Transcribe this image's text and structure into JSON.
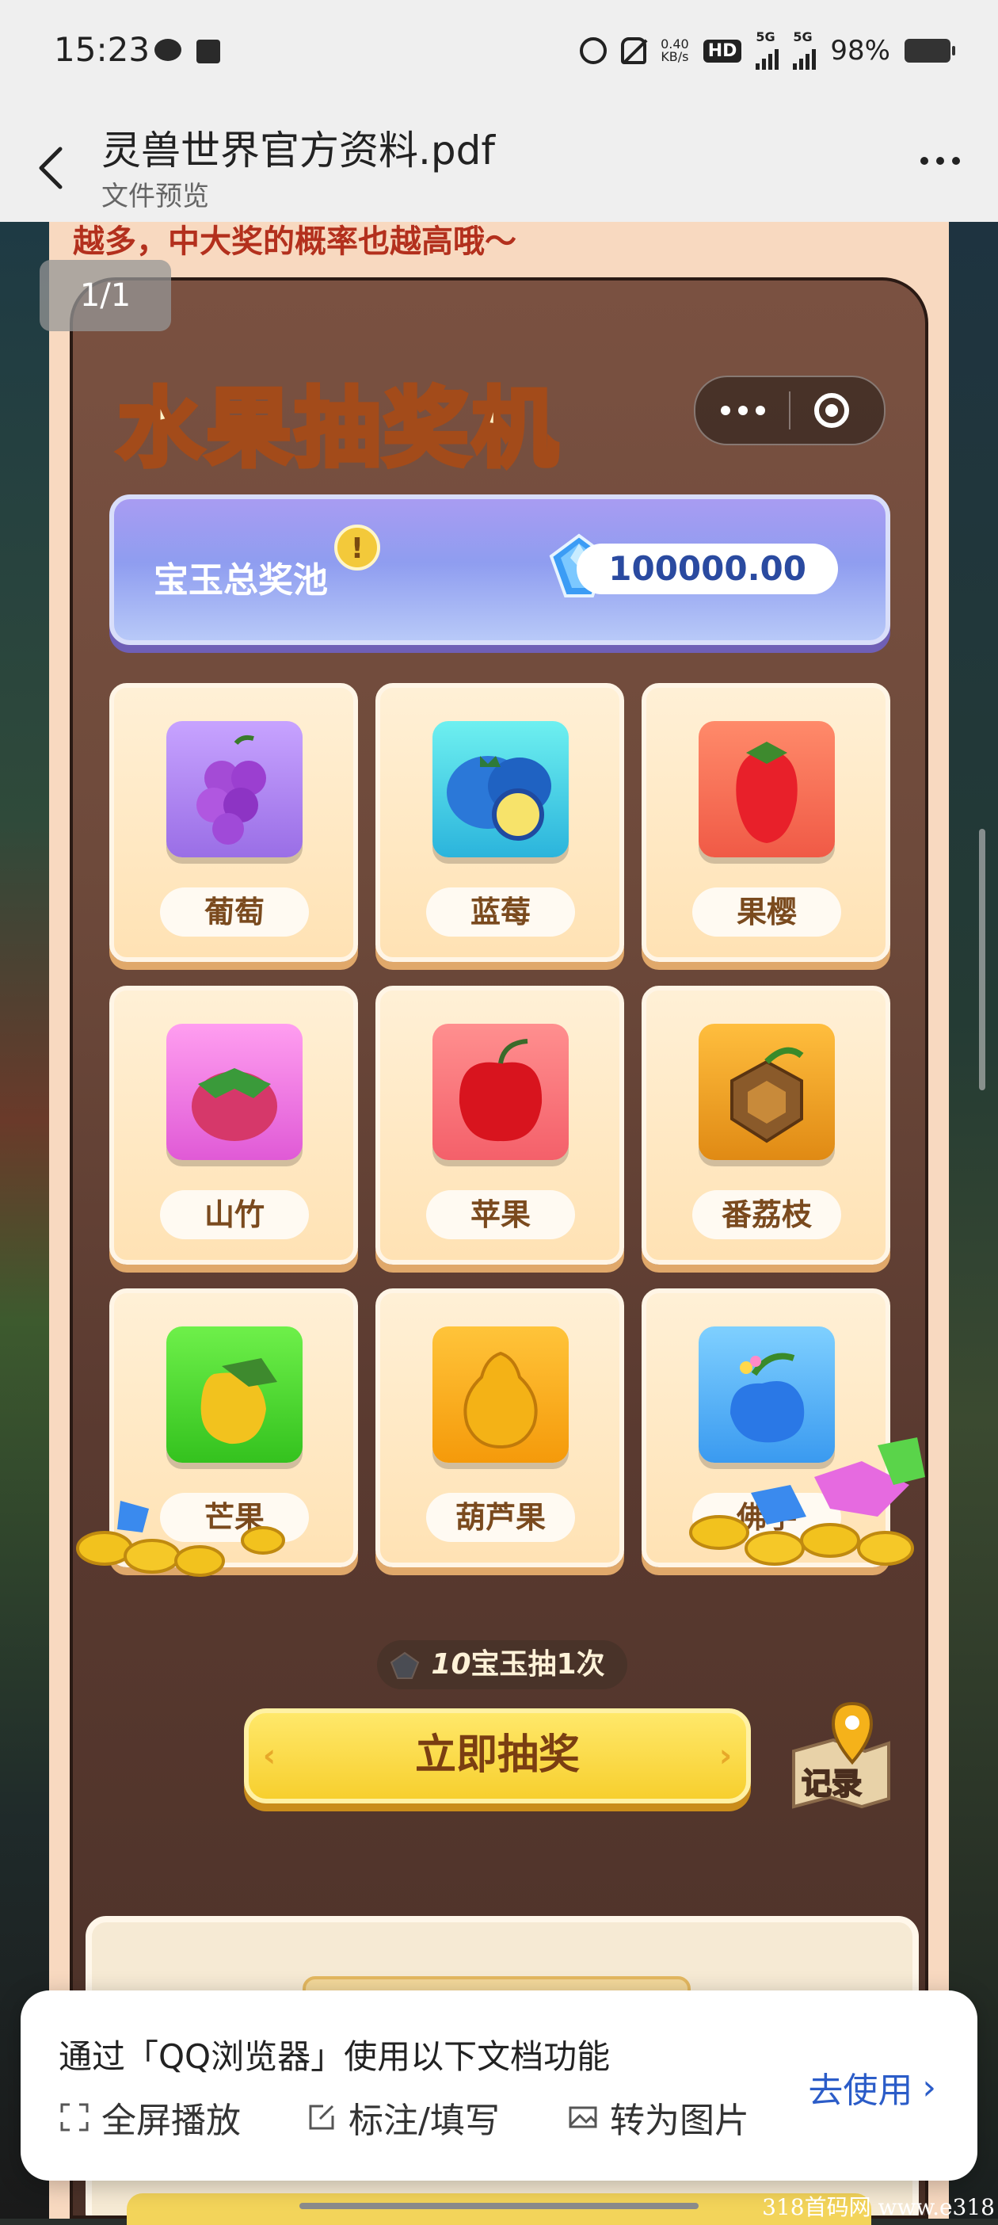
{
  "status_bar": {
    "time": "15:23",
    "speed_value": "0.40",
    "speed_unit": "KB/s",
    "hd_label": "HD",
    "network_1": "5G",
    "network_2": "5G",
    "battery": "98%"
  },
  "header": {
    "title": "灵兽世界官方资料.pdf",
    "subtitle": "文件预览"
  },
  "document": {
    "top_text": "越多，中大奖的概率也越高哦～",
    "page_indicator": "1/1"
  },
  "mini_program": {
    "title": "水果抽奖机",
    "pool": {
      "label": "宝玉总奖池",
      "info_symbol": "!",
      "value": "100000.00"
    },
    "fruits": [
      {
        "name": "葡萄",
        "color": "#b98cf0"
      },
      {
        "name": "蓝莓",
        "color": "#4fd3e8"
      },
      {
        "name": "果樱",
        "color": "#ff6a5a"
      },
      {
        "name": "山竹",
        "color": "#f08ae8"
      },
      {
        "name": "苹果",
        "color": "#ff7f7f"
      },
      {
        "name": "番荔枝",
        "color": "#f5a52a"
      },
      {
        "name": "芒果",
        "color": "#5fdc3a"
      },
      {
        "name": "葫芦果",
        "color": "#ffb01a"
      },
      {
        "name": "佛手",
        "color": "#56b4f5"
      }
    ],
    "cost_number": "10",
    "cost_text": "宝玉抽1次",
    "draw_button": "立即抽奖",
    "record_label": "记录"
  },
  "qq_popup": {
    "title": "通过「QQ浏览器」使用以下文档功能",
    "features": [
      "全屏播放",
      "标注/填写",
      "转为图片"
    ],
    "action": "去使用"
  },
  "watermark": "318首码网  www.e318"
}
